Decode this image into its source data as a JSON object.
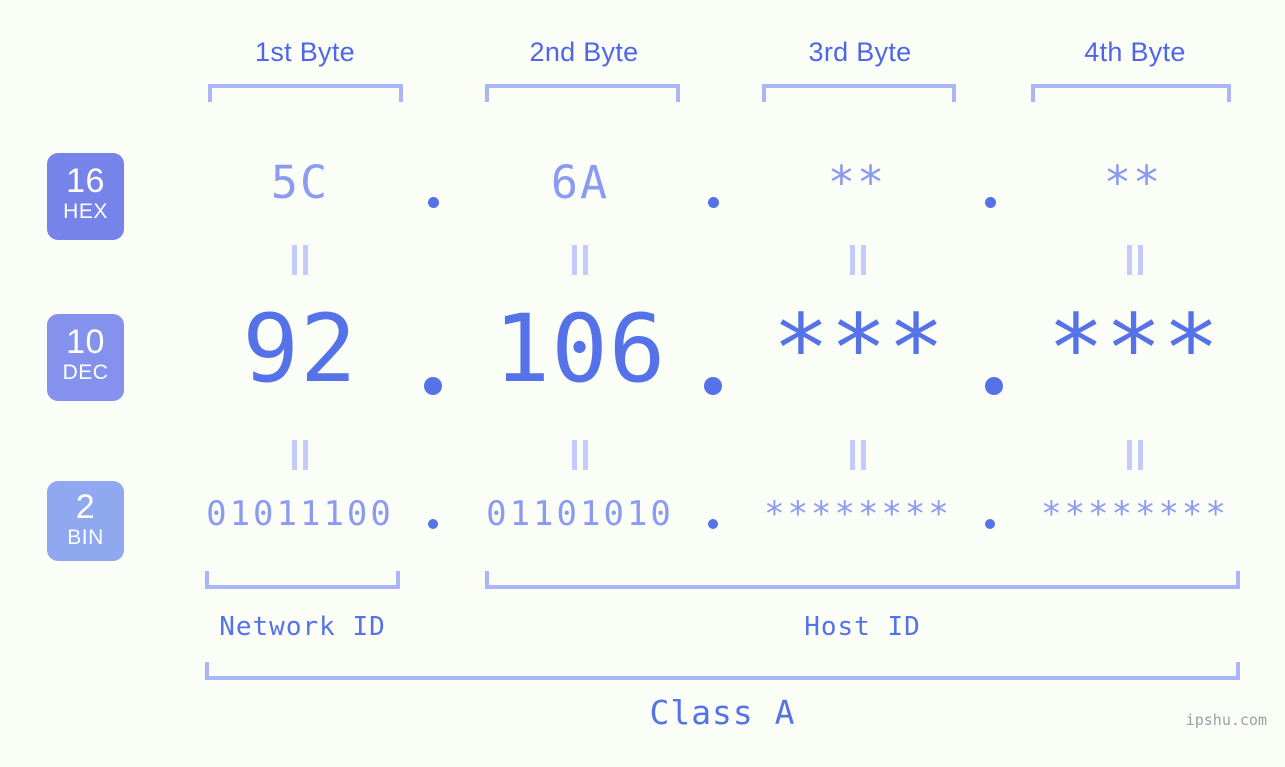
{
  "watermark": "ipshu.com",
  "byte_headers": [
    {
      "label": "1st Byte"
    },
    {
      "label": "2nd Byte"
    },
    {
      "label": "3rd Byte"
    },
    {
      "label": "4th Byte"
    }
  ],
  "bases": [
    {
      "radix": "16",
      "abbr": "HEX",
      "color": "#7683e8"
    },
    {
      "radix": "10",
      "abbr": "DEC",
      "color": "#8492ee"
    },
    {
      "radix": "2",
      "abbr": "BIN",
      "color": "#8fa8f0"
    }
  ],
  "rows": {
    "hex": {
      "name": "HEX",
      "values": [
        "5C",
        "6A",
        "**",
        "**"
      ],
      "separator": "."
    },
    "dec": {
      "name": "DEC",
      "values": [
        "92",
        "106",
        "***",
        "***"
      ],
      "separator": "."
    },
    "bin": {
      "name": "BIN",
      "values": [
        "01011100",
        "01101010",
        "********",
        "********"
      ],
      "separator": "."
    }
  },
  "equals_marks": "||",
  "segments": {
    "network_id": "Network ID",
    "host_id": "Host ID"
  },
  "class_label": "Class A",
  "colors": {
    "background": "#fbfdf7",
    "accent_strong": "#5572e8",
    "accent_light": "#8b9bf2",
    "bracket": "#aab6f7",
    "eq_mark": "#c2cbfa",
    "header_text": "#4f66e8",
    "watermark": "#9aa0a6"
  }
}
